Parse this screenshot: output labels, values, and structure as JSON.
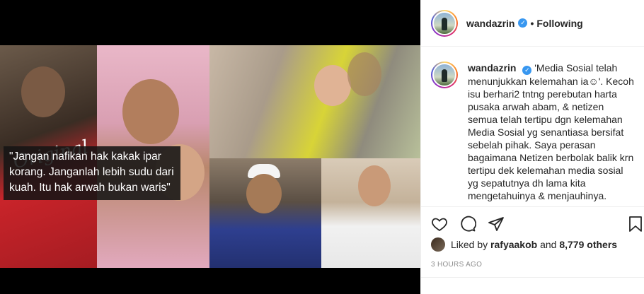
{
  "post": {
    "username": "wandazrin",
    "follow_status": "Following",
    "separator": "•",
    "verified_glyph": "✓"
  },
  "media": {
    "shirt_text": "Original",
    "quote_lines": [
      "\"Jangan nafikan hak kakak ipar",
      "korang. Janganlah lebih sudu dari",
      "kuah. Itu hak arwah bukan waris\""
    ]
  },
  "caption": {
    "username": "wandazrin",
    "text": "'Media Sosial telah menunjukkan kelemahan ia☺'. Kecoh isu berhari2 tntng perebutan harta pusaka arwah abam, & netizen semua telah tertipu dgn kelemahan Media Sosial yg senantiasa bersifat sebelah pihak. Saya perasan bagaimana Netizen berbolak balik krn tertipu dek kelemahan media sosial yg sepatutnya dh lama kita mengetahuinya & menjauhinya."
  },
  "actions": {
    "icons": [
      "heart-icon",
      "comment-icon",
      "share-icon",
      "bookmark-icon"
    ]
  },
  "likes": {
    "prefix": "Liked by",
    "user": "rafyaakob",
    "middle": "and",
    "others": "8,779 others"
  },
  "timestamp": "3 HOURS AGO",
  "colors": {
    "verified": "#3897f0",
    "text": "#262626",
    "muted": "#8e8e8e"
  }
}
